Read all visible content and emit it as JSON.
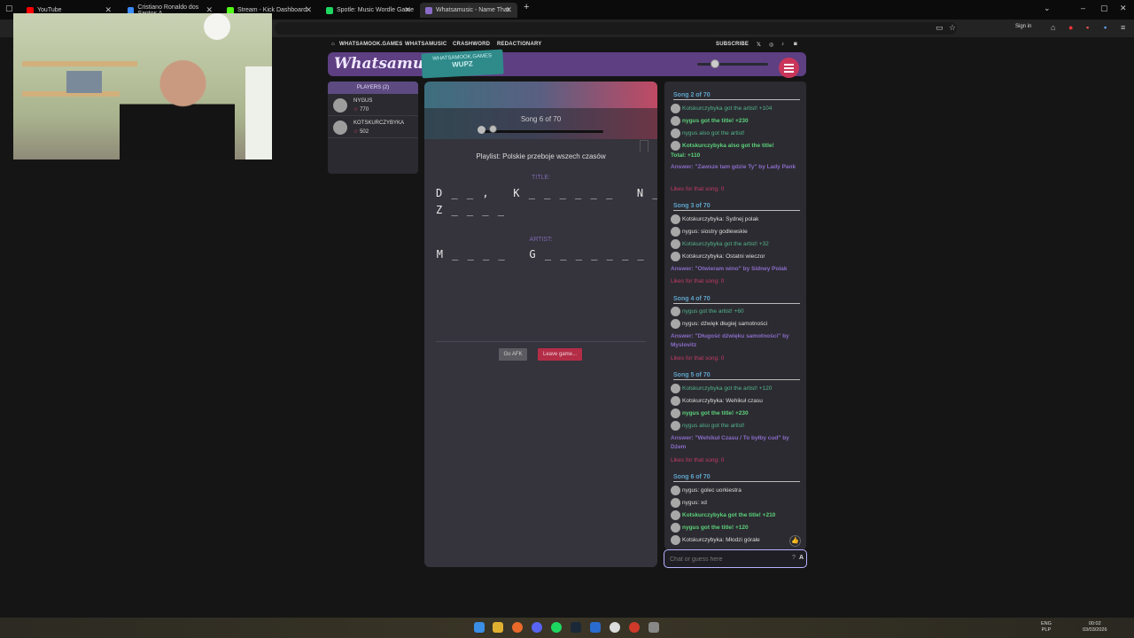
{
  "browser": {
    "tabs": [
      {
        "label": "YouTube",
        "color": "#ff0000"
      },
      {
        "label": "Cristiano Ronaldo dos Santos A",
        "color": "#3c8cff"
      },
      {
        "label": "Stream - Kick Dashboard",
        "color": "#53fc18"
      },
      {
        "label": "Spotle: Music Wordle Game",
        "color": "#1ed760"
      },
      {
        "label": "Whatsamusic - Name That",
        "color": "#8a6cc8"
      }
    ],
    "new_tab": "+",
    "sign_in": "Sign in"
  },
  "nav": {
    "home": "WHATSAMOOK.GAMES",
    "whatsamusic": "WHATSAMUSIC",
    "crashword": "CRASHWORD",
    "redactionary": "REDACTIONARY",
    "subscribe": "SUBSCRIBE"
  },
  "header": {
    "logo": "Whatsamusic",
    "badge_top": "WHATSAMOOK.GAMES",
    "badge_code": "WUPZ"
  },
  "players": {
    "title": "PLAYERS (2)",
    "list": [
      {
        "name": "NYGUS",
        "score": "770"
      },
      {
        "name": "KOTSKURCZYBYKA",
        "score": "502"
      }
    ]
  },
  "game": {
    "song_counter": "Song 6 of 70",
    "playlist": "Playlist: Polskie przeboje wszech czasów",
    "title_label": "TITLE:",
    "title_hint_1": "D _ _ ,   K _ _ _ _ _ _   N _ _",
    "title_hint_2": "Z _ _ _ _",
    "artist_label": "ARTIST:",
    "artist_hint": "M _ _ _ _   G _ _ _ _ _ _ _",
    "afk_button": "Go AFK",
    "leave_button": "Leave game..."
  },
  "chat": {
    "s2": "Song 2 of 70",
    "s2_l1": "Kotskurczybyka got the artist! +104",
    "s2_l2": "nygus got the title! +230",
    "s2_l3": "nygus also got the artist!",
    "s2_l4": "Kotskurczybyka also got the title!",
    "s2_l4b": "Total: +110",
    "s2_ans": "Answer: \"Zawsze tam gdzie Ty\" by Lady Pank",
    "s2_likes": "Likes for that song: 0",
    "s3": "Song 3 of 70",
    "s3_l1": "Kotskurczybyka: Sydnej polak",
    "s3_l2": "nygus: siostry godlewskie",
    "s3_l3": "Kotskurczybyka got the artist! +32",
    "s3_l4": "Kotskurczybyka: Ostatni wieczor",
    "s3_ans": "Answer: \"Otwieram wino\" by Sidney Polak",
    "s3_likes": "Likes for that song: 0",
    "s4": "Song 4 of 70",
    "s4_l1": "nygus got the artist! +60",
    "s4_l2": "nygus: dźwięk długiej samotności",
    "s4_ans": "Answer: \"Długość dźwięku samotności\" by Myslovitz",
    "s4_likes": "Likes for that song: 0",
    "s5": "Song 5 of 70",
    "s5_l1": "Kotskurczybyka got the artist! +120",
    "s5_l2": "Kotskurczybyka: Wehikuł czasu",
    "s5_l3": "nygus got the title! +230",
    "s5_l4": "nygus also got the artist!",
    "s5_ans": "Answer: \"Wehikuł Czasu / To byłby cud\" by Dżem",
    "s5_likes": "Likes for that song: 0",
    "s6": "Song 6 of 70",
    "s6_l1": "nygus: golec uorkiestra",
    "s6_l2": "nygus: xd",
    "s6_l3": "Kotskurczybyka got the title! +210",
    "s6_l4": "nygus got the title! +120",
    "s6_l5": "Kotskurczybyka: Młodzi górale",
    "placeholder": "Chat or guess here"
  },
  "taskbar": {
    "lang": "ENG",
    "lang2": "PLP",
    "time": "00:02",
    "date": "03/03/2026"
  },
  "colors": {
    "accent": "#5d3f82",
    "danger": "#b32d47",
    "teal": "#2f8a8a"
  }
}
